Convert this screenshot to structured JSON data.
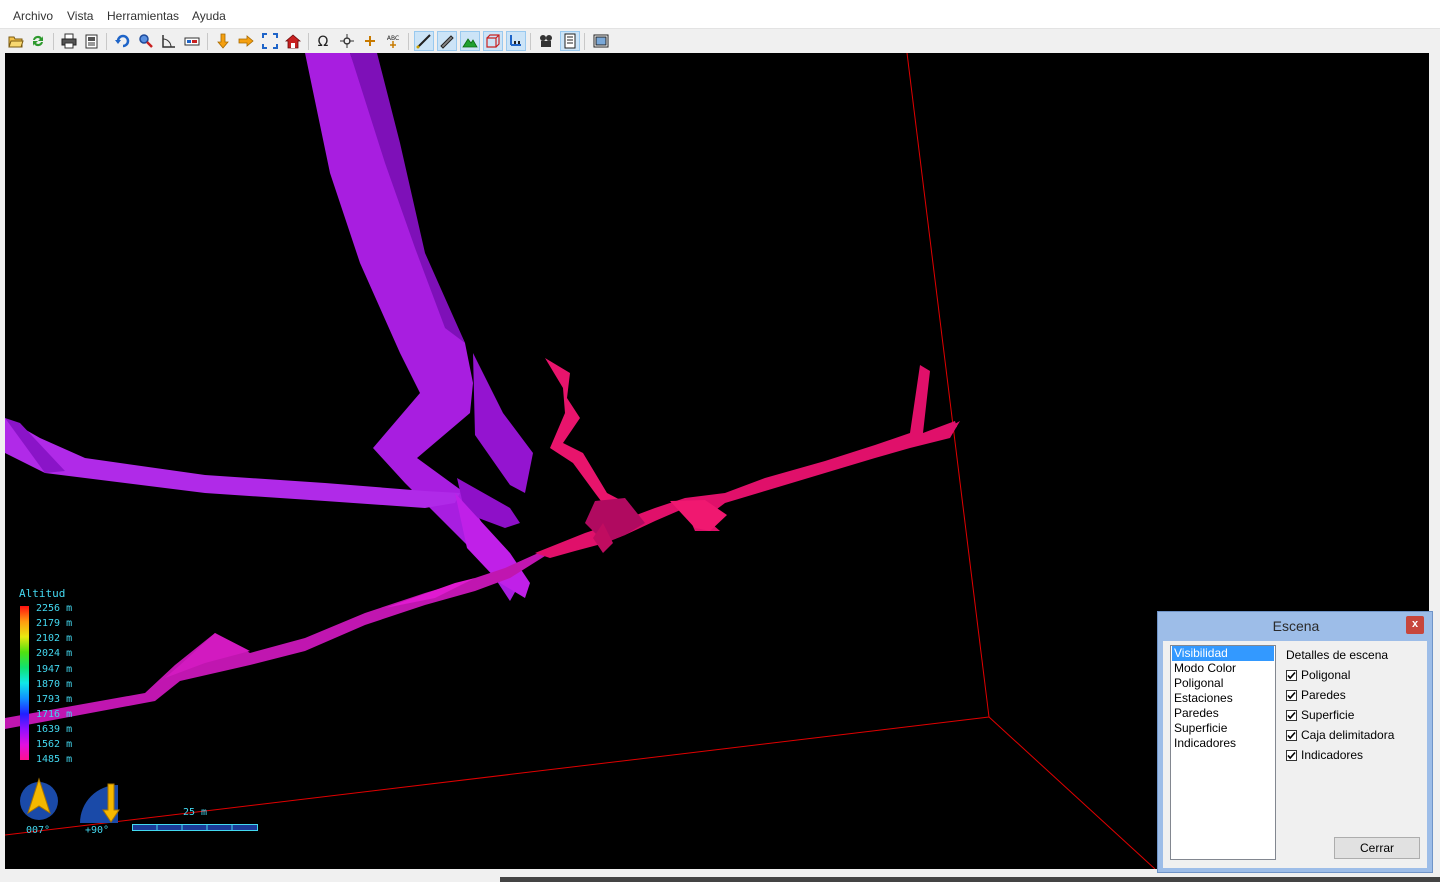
{
  "menu": [
    "Archivo",
    "Vista",
    "Herramientas",
    "Ayuda"
  ],
  "toolbar": {
    "buttons": [
      {
        "icon": "open-folder-icon"
      },
      {
        "icon": "refresh-icon"
      },
      {
        "icon": "print-icon"
      },
      {
        "icon": "print-preview-icon"
      },
      {
        "icon": "rotate-icon"
      },
      {
        "icon": "zoom-icon"
      },
      {
        "icon": "angle-icon"
      },
      {
        "icon": "measure-icon"
      },
      {
        "icon": "arrow-down-icon"
      },
      {
        "icon": "arrow-right-icon"
      },
      {
        "icon": "fit-view-icon"
      },
      {
        "icon": "home-icon"
      },
      {
        "icon": "omega-icon"
      },
      {
        "icon": "crosshair-icon"
      },
      {
        "icon": "plus-icon"
      },
      {
        "icon": "label-icon"
      },
      {
        "icon": "polygon-line-icon",
        "active": true
      },
      {
        "icon": "walls-icon",
        "active": true
      },
      {
        "icon": "surface-icon",
        "active": true
      },
      {
        "icon": "bounding-box-icon",
        "active": true
      },
      {
        "icon": "indicators-icon",
        "active": true
      },
      {
        "icon": "film-icon"
      },
      {
        "icon": "scene-panel-icon",
        "active": true
      },
      {
        "icon": "window-icon"
      }
    ]
  },
  "legend": {
    "title": "Altitud",
    "labels": [
      "2256 m",
      "2179 m",
      "2102 m",
      "2024 m",
      "1947 m",
      "1870 m",
      "1793 m",
      "1716 m",
      "1639 m",
      "1562 m",
      "1485 m"
    ],
    "colors": [
      "#ff1010",
      "#ff9a10",
      "#e8e810",
      "#50e010",
      "#10e070",
      "#10e8e8",
      "#1090ff",
      "#2020ff",
      "#9010ff",
      "#e010e0",
      "#ff1090"
    ]
  },
  "hud": {
    "heading": "007°",
    "tilt": "+90°",
    "scale": "25 m"
  },
  "dialog": {
    "title": "Escena",
    "close_symbol": "x",
    "categories": [
      "Visibilidad",
      "Modo Color",
      "Poligonal",
      "Estaciones",
      "Paredes",
      "Superficie",
      "Indicadores"
    ],
    "selected_category": "Visibilidad",
    "details_title": "Detalles de escena",
    "options": [
      {
        "label": "Poligonal",
        "checked": true
      },
      {
        "label": "Paredes",
        "checked": true
      },
      {
        "label": "Superficie",
        "checked": true
      },
      {
        "label": "Caja delimitadora",
        "checked": true
      },
      {
        "label": "Indicadores",
        "checked": true
      }
    ],
    "close_button": "Cerrar"
  }
}
